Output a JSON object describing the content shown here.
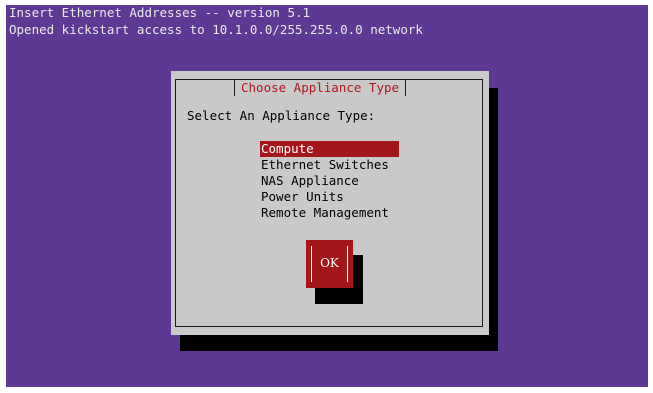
{
  "terminal": {
    "lines": [
      "Insert Ethernet Addresses -- version 5.1",
      "Opened kickstart access to 10.1.0.0/255.255.0.0 network"
    ],
    "background_color": "#5e3993",
    "text_color": "#e9e9e9"
  },
  "dialog": {
    "title": "Choose Appliance Type",
    "prompt": "Select An Appliance Type:",
    "items": [
      "Compute",
      "Ethernet Switches",
      "NAS Appliance",
      "Power Units",
      "Remote Management"
    ],
    "selected": "Compute",
    "ok_label": "OK",
    "background_color": "#c9c9c9",
    "accent_color": "#a3171b"
  }
}
